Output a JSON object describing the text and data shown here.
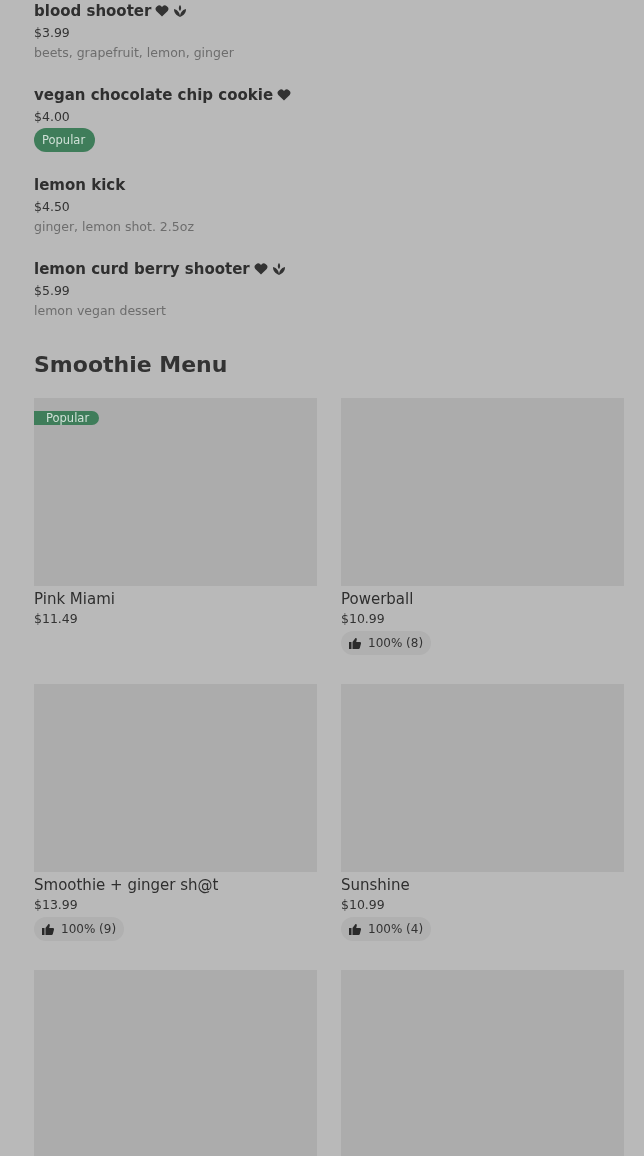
{
  "items": [
    {
      "name": "blood shooter",
      "icons": [
        {
          "kind": "heart"
        },
        {
          "kind": "leaf"
        }
      ],
      "price": "$3.99",
      "description": "beets, grapefruit, lemon, ginger"
    },
    {
      "name": "vegan chocolate chip cookie",
      "icons": [
        {
          "kind": "heart"
        }
      ],
      "price": "$4.00",
      "badge": "Popular"
    },
    {
      "name": "lemon kick",
      "price": "$4.50",
      "description": "ginger, lemon shot. 2.5oz"
    },
    {
      "name": "lemon curd berry shooter",
      "icons": [
        {
          "kind": "heart"
        },
        {
          "kind": "leaf"
        }
      ],
      "price": "$5.99",
      "description": "lemon vegan dessert"
    }
  ],
  "section_title": "Smoothie Menu",
  "cards": [
    {
      "kind": "picture",
      "name": "Pink Miami",
      "price": "$11.49",
      "badge": "Popular"
    },
    {
      "kind": "picture",
      "name": "Powerball",
      "price": "$10.99",
      "rating": "100% (8)"
    },
    {
      "kind": "picture",
      "name": "Smoothie + ginger sh@t",
      "price": "$13.99",
      "rating": "100% (9)"
    },
    {
      "kind": "picture",
      "name": "Sunshine",
      "price": "$10.99",
      "rating": "100% (4)"
    },
    {
      "kind": "picture"
    },
    {
      "kind": "picture"
    }
  ]
}
